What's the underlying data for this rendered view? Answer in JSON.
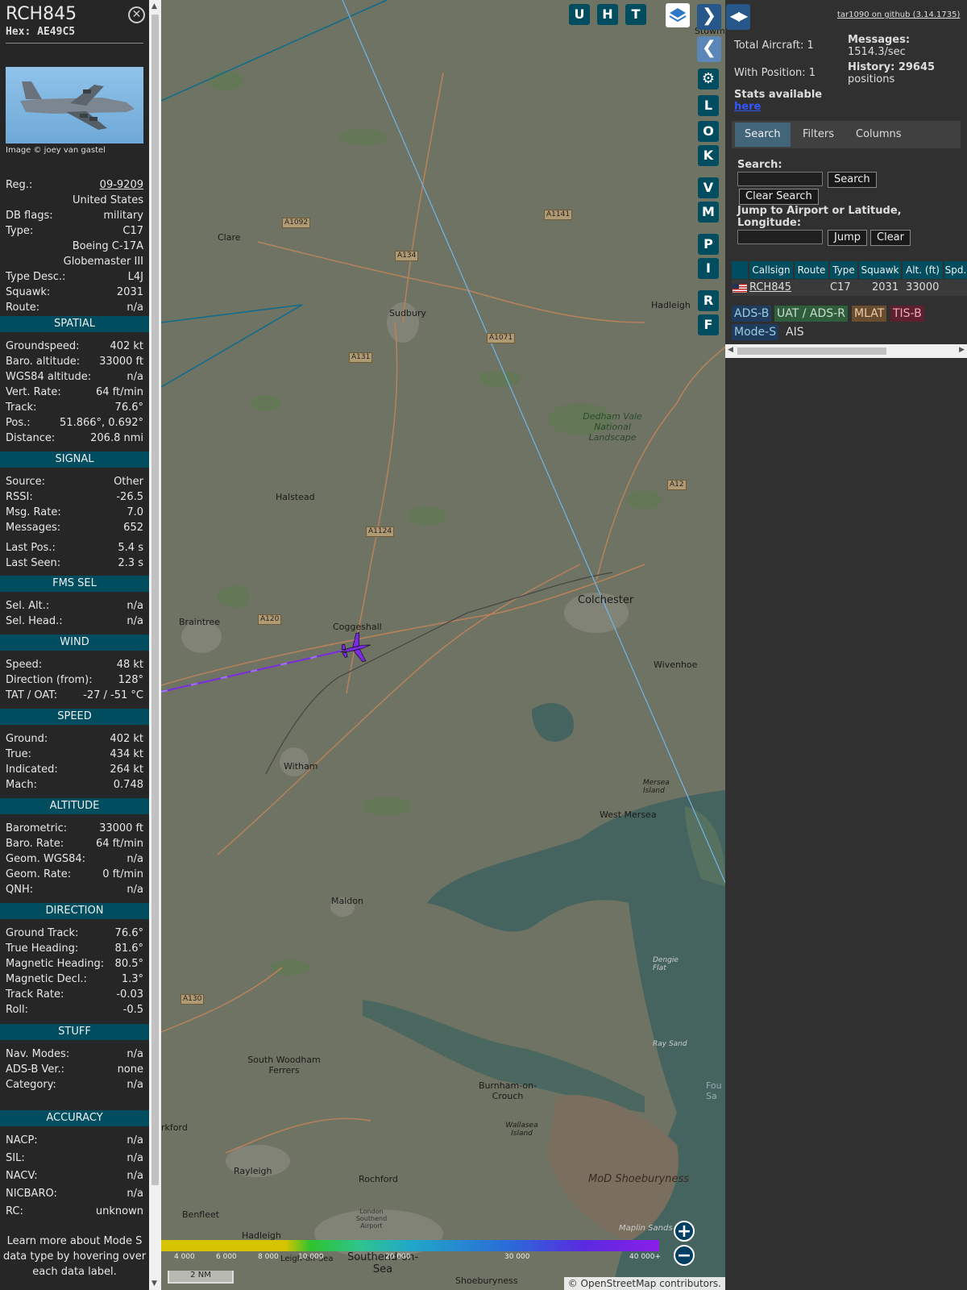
{
  "aircraft": {
    "callsign": "RCH845",
    "hex": "Hex: AE49C5",
    "photo_credit": "Image © joey van gastel"
  },
  "basic": [
    {
      "k": "Reg.:",
      "v": "09-9209"
    },
    {
      "k": "",
      "v": "United States"
    },
    {
      "k": "DB flags:",
      "v": "military"
    },
    {
      "k": "Type:",
      "v": "C17"
    },
    {
      "k": "",
      "v": "Boeing C-17A"
    },
    {
      "k": "",
      "v": "Globemaster III"
    },
    {
      "k": "Type Desc.:",
      "v": "L4J"
    },
    {
      "k": "Squawk:",
      "v": "2031"
    },
    {
      "k": "Route:",
      "v": "n/a"
    }
  ],
  "sections": {
    "spatial": {
      "title": "SPATIAL",
      "rows": [
        {
          "k": "Groundspeed:",
          "v": "402 kt"
        },
        {
          "k": "Baro. altitude:",
          "v": "33000 ft"
        },
        {
          "k": "WGS84 altitude:",
          "v": "n/a"
        },
        {
          "k": "Vert. Rate:",
          "v": "64 ft/min"
        },
        {
          "k": "Track:",
          "v": "76.6°"
        },
        {
          "k": "Pos.:",
          "v": "51.866°, 0.692°"
        },
        {
          "k": "Distance:",
          "v": "206.8 nmi"
        }
      ]
    },
    "signal": {
      "title": "SIGNAL",
      "rows": [
        {
          "k": "Source:",
          "v": "Other"
        },
        {
          "k": "RSSI:",
          "v": "-26.5"
        },
        {
          "k": "Msg. Rate:",
          "v": "7.0"
        },
        {
          "k": "Messages:",
          "v": "652"
        },
        {
          "k": "Last Pos.:",
          "v": "5.4 s"
        },
        {
          "k": "Last Seen:",
          "v": "2.3 s"
        }
      ]
    },
    "fms": {
      "title": "FMS SEL",
      "rows": [
        {
          "k": "Sel. Alt.:",
          "v": "n/a"
        },
        {
          "k": "Sel. Head.:",
          "v": "n/a"
        }
      ]
    },
    "wind": {
      "title": "WIND",
      "rows": [
        {
          "k": "Speed:",
          "v": "48 kt"
        },
        {
          "k": "Direction (from):",
          "v": "128°"
        },
        {
          "k": "TAT / OAT:",
          "v": "-27 / -51 °C"
        }
      ]
    },
    "speed": {
      "title": "SPEED",
      "rows": [
        {
          "k": "Ground:",
          "v": "402 kt"
        },
        {
          "k": "True:",
          "v": "434 kt"
        },
        {
          "k": "Indicated:",
          "v": "264 kt"
        },
        {
          "k": "Mach:",
          "v": "0.748"
        }
      ]
    },
    "altitude": {
      "title": "ALTITUDE",
      "rows": [
        {
          "k": "Barometric:",
          "v": "33000 ft"
        },
        {
          "k": "Baro. Rate:",
          "v": "64 ft/min"
        },
        {
          "k": "Geom. WGS84:",
          "v": "n/a"
        },
        {
          "k": "Geom. Rate:",
          "v": "0 ft/min"
        },
        {
          "k": "QNH:",
          "v": "n/a"
        }
      ]
    },
    "direction": {
      "title": "DIRECTION",
      "rows": [
        {
          "k": "Ground Track:",
          "v": "76.6°"
        },
        {
          "k": "True Heading:",
          "v": "81.6°"
        },
        {
          "k": "Magnetic Heading:",
          "v": "80.5°"
        },
        {
          "k": "Magnetic Decl.:",
          "v": "1.3°"
        },
        {
          "k": "Track Rate:",
          "v": "-0.03"
        },
        {
          "k": "Roll:",
          "v": "-0.5"
        }
      ]
    },
    "stuff": {
      "title": "STUFF",
      "rows": [
        {
          "k": "Nav. Modes:",
          "v": "n/a"
        },
        {
          "k": "ADS-B Ver.:",
          "v": "none"
        },
        {
          "k": "Category:",
          "v": "n/a"
        }
      ]
    },
    "accuracy": {
      "title": "ACCURACY",
      "rows": [
        {
          "k": "NACP:",
          "v": "n/a"
        },
        {
          "k": "SIL:",
          "v": "n/a"
        },
        {
          "k": "NACV:",
          "v": "n/a"
        },
        {
          "k": "NICBARO:",
          "v": "n/a"
        },
        {
          "k": "RC:",
          "v": "unknown"
        }
      ]
    }
  },
  "footer_note": "Learn more about Mode S data type by hovering over each data label.",
  "map": {
    "buttons_top": [
      "U",
      "H",
      "T"
    ],
    "buttons_side": [
      "L",
      "O",
      "K",
      "V",
      "M",
      "P",
      "I",
      "R",
      "F"
    ],
    "places": [
      "Clare",
      "Sudbury",
      "Hadleigh",
      "Halstead",
      "Braintree",
      "Coggeshall",
      "Colchester",
      "Wivenhoe",
      "Witham",
      "Maldon",
      "West Mersea",
      "Mersea Island",
      "South Woodham Ferrers",
      "Burnham-on-Crouch",
      "Wallasea Island",
      "Rayleigh",
      "Rochford",
      "Benfleet",
      "Hadleigh",
      "Southend-on-Sea",
      "Shoeburyness",
      "MoD Shoeburyness",
      "Dedham Vale National Landscape",
      "Dengie Flat",
      "Ray Sand",
      "Maplin Sands",
      "Leigh-on-Sea",
      "London Southend Airport",
      "Stowm",
      "rkford",
      "Fou Sa"
    ],
    "roads": [
      "A1092",
      "A134",
      "A1141",
      "A1071",
      "A131",
      "A12",
      "A1124",
      "A120",
      "A130"
    ],
    "alt_legend": [
      "4 000",
      "6 000",
      "8 000",
      "10 000",
      "20 000",
      "30 000",
      "40 000+"
    ],
    "scale": "2 NM",
    "attribution": "© OpenStreetMap contributors."
  },
  "right": {
    "github": "tar1090 on github (3.14.1735)",
    "total_aircraft": "Total Aircraft: 1",
    "with_position": "With Position: 1",
    "messages_label": "Messages:",
    "messages_rate": "1514.3/sec",
    "history_label": "History: 29645",
    "history_positions": "positions",
    "stats_text": "Stats available",
    "stats_link": "here",
    "tabs": [
      "Search",
      "Filters",
      "Columns"
    ],
    "search_label": "Search:",
    "search_btn": "Search",
    "clear_search_btn": "Clear Search",
    "jump_label": "Jump to Airport or Latitude, Longitude:",
    "jump_btn": "Jump",
    "clear_btn": "Clear",
    "columns": [
      "",
      "Callsign",
      "Route",
      "Type",
      "Squawk",
      "Alt. (ft)",
      "Spd."
    ],
    "row": {
      "callsign": "RCH845",
      "route": "",
      "type": "C17",
      "squawk": "2031",
      "alt": "33000",
      "spd": ""
    },
    "sources": [
      "ADS-B",
      "UAT / ADS-R",
      "MLAT",
      "TIS-B",
      "Mode-S",
      "AIS"
    ]
  },
  "colors": {
    "section_bg": "#004d5f",
    "button_bg": "#004d5f",
    "aircraft": "#7a2de0",
    "adsb": "#1f3b5e",
    "uat": "#2e5e3b",
    "mlat": "#6a4d2f",
    "tisb": "#5e1f2e"
  }
}
